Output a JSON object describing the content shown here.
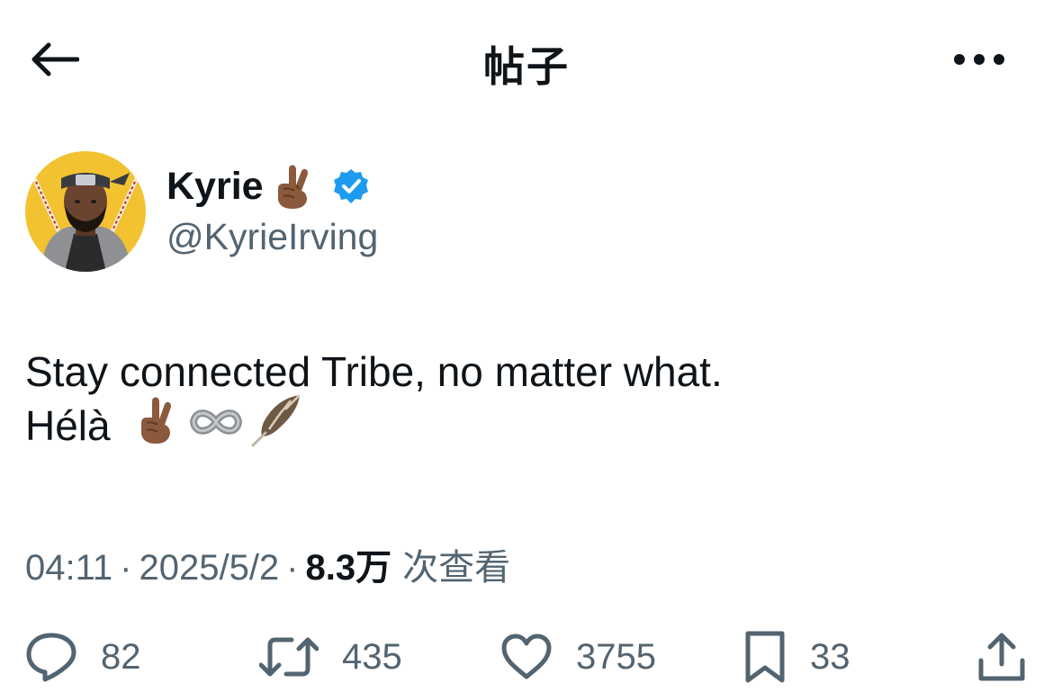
{
  "header": {
    "title": "帖子",
    "back_icon": "arrow-left-icon",
    "more_icon": "more-horizontal-icon"
  },
  "author": {
    "display_name": "Kyrie",
    "name_emoji": "crossed-fingers-emoji",
    "verified_icon": "verified-badge-icon",
    "verified_color": "#1d9bf0",
    "handle": "@KyrieIrving",
    "avatar_bg": "#f2c230"
  },
  "tweet": {
    "line1": "Stay connected Tribe, no matter what.",
    "line2_text": "Hélà",
    "line2_emojis": [
      "crossed-fingers-emoji",
      "infinity-emoji",
      "feather-emoji"
    ]
  },
  "meta": {
    "time": "04:11",
    "dot1": "·",
    "date": "2025/5/2",
    "dot2": "·",
    "views_count": "8.3万",
    "views_label": "次查看"
  },
  "actions": {
    "replies": "82",
    "retweets": "435",
    "likes": "3755",
    "bookmarks": "33"
  },
  "colors": {
    "text": "#0f1419",
    "secondary": "#536471",
    "accent": "#1d9bf0"
  }
}
